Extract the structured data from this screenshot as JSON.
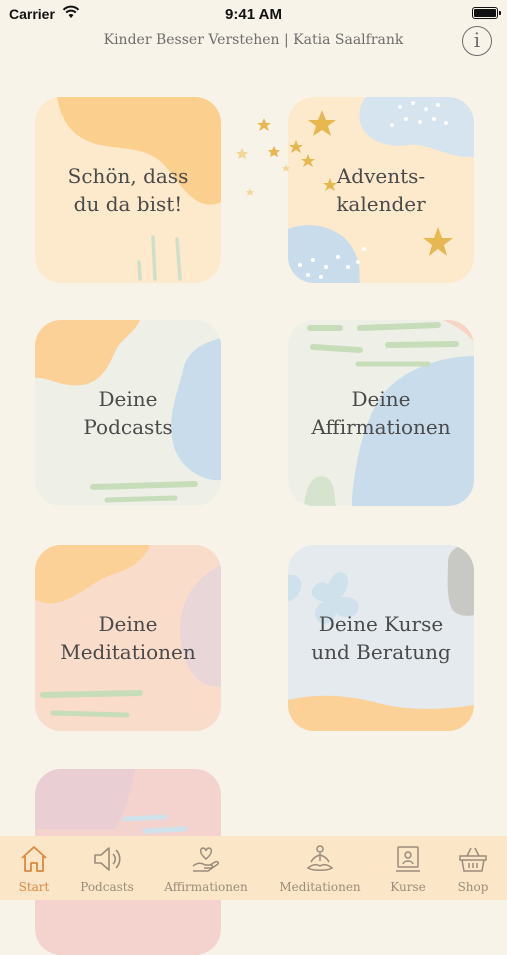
{
  "status_bar": {
    "carrier": "Carrier",
    "time": "9:41 AM"
  },
  "header": {
    "title": "Kinder Besser Verstehen | Katia Saalfrank",
    "info_label": "i"
  },
  "tiles": [
    {
      "line1": "Schön, dass",
      "line2": "du da bist!"
    },
    {
      "line1": "Advents-",
      "line2": "kalender"
    },
    {
      "line1": "Deine",
      "line2": "Podcasts"
    },
    {
      "line1": "Deine",
      "line2": "Affirmationen"
    },
    {
      "line1": "Deine",
      "line2": "Meditationen"
    },
    {
      "line1": "Deine Kurse",
      "line2": "und Beratung"
    }
  ],
  "tab_bar": [
    {
      "label": "Start",
      "icon": "home-icon",
      "active": true
    },
    {
      "label": "Podcasts",
      "icon": "speaker-icon"
    },
    {
      "label": "Affirmationen",
      "icon": "heart-hand-icon"
    },
    {
      "label": "Meditationen",
      "icon": "meditation-icon"
    },
    {
      "label": "Kurse",
      "icon": "course-icon"
    },
    {
      "label": "Shop",
      "icon": "basket-icon"
    }
  ],
  "colors": {
    "accent": "#e0883f",
    "background": "#f8f3e8",
    "tab_bar": "#fbe7c7"
  }
}
